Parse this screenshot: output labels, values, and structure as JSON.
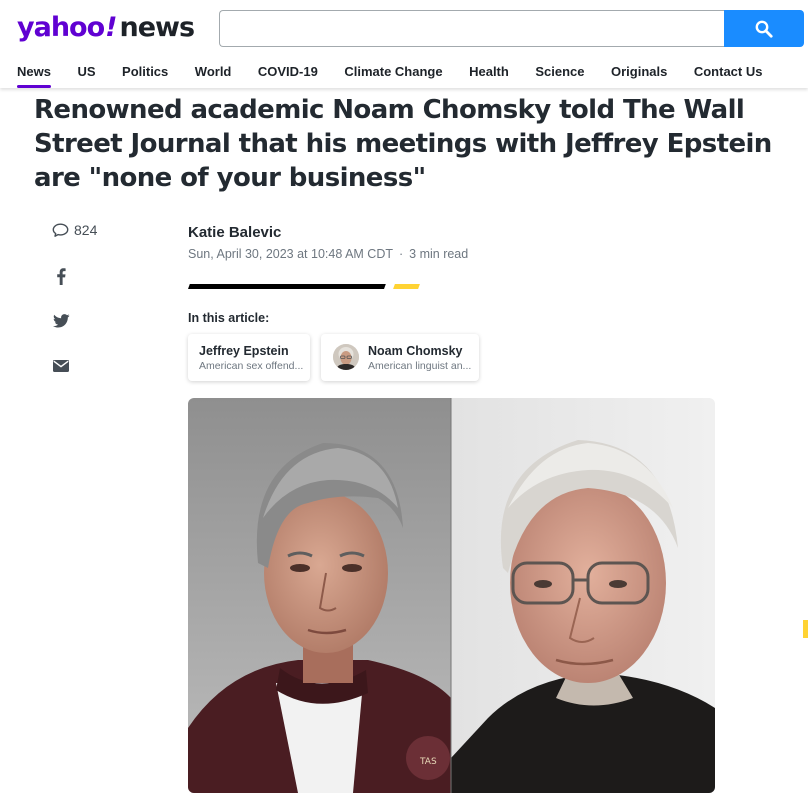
{
  "header": {
    "logo": {
      "brand": "yahoo",
      "bang": "!",
      "section": "news"
    },
    "search": {
      "value": "",
      "placeholder": "",
      "button_icon": "search-icon"
    },
    "nav": [
      {
        "label": "News",
        "active": true
      },
      {
        "label": "US"
      },
      {
        "label": "Politics"
      },
      {
        "label": "World"
      },
      {
        "label": "COVID-19"
      },
      {
        "label": "Climate Change"
      },
      {
        "label": "Health"
      },
      {
        "label": "Science"
      },
      {
        "label": "Originals"
      },
      {
        "label": "Contact Us"
      }
    ]
  },
  "article": {
    "headline": "Renowned academic Noam Chomsky told The Wall Street Journal that his meetings with Jeffrey Epstein are \"none of your business\"",
    "comments_count": "824",
    "share_icons": [
      "facebook-icon",
      "twitter-icon",
      "email-icon"
    ],
    "author": "Katie Balevic",
    "date": "Sun, April 30, 2023 at 10:48 AM CDT",
    "separator": "·",
    "read_time": "3 min read",
    "in_this_article_label": "In this article:",
    "entities": [
      {
        "name": "Jeffrey Epstein",
        "description": "American sex offend..."
      },
      {
        "name": "Noam Chomsky",
        "description": "American linguist an..."
      }
    ],
    "photo_badge": "TAS"
  },
  "colors": {
    "brand_purple": "#6001d2",
    "search_blue": "#1a8cff",
    "accent_yellow": "#ffd333",
    "text_dark": "#232a31",
    "text_muted": "#6e7780"
  }
}
